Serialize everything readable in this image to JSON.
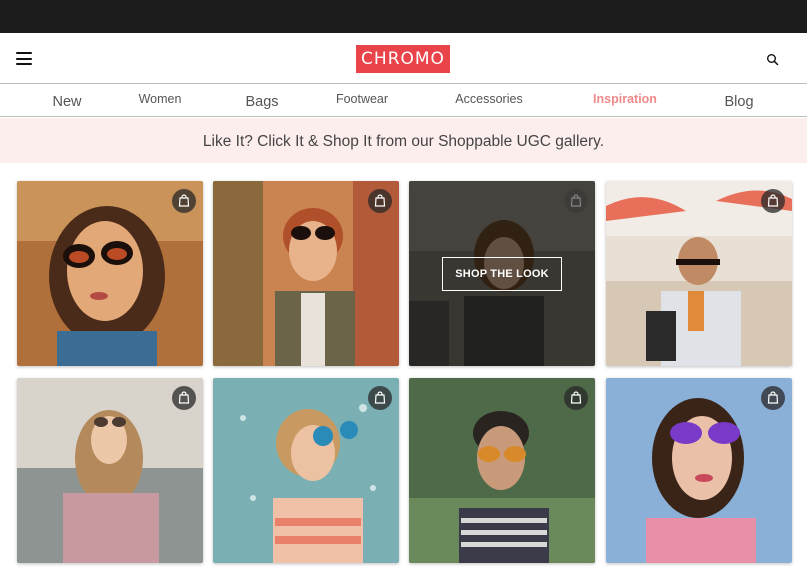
{
  "header": {
    "logo": "CHROMO",
    "menu_icon": "hamburger-menu-icon",
    "search_icon": "search-icon"
  },
  "nav": {
    "items": [
      {
        "label": "New"
      },
      {
        "label": "Women"
      },
      {
        "label": "Bags"
      },
      {
        "label": "Footwear"
      },
      {
        "label": "Accessories"
      },
      {
        "label": "Inspiration",
        "active": true
      },
      {
        "label": "Blog"
      }
    ]
  },
  "banner": {
    "text": "Like It? Click It & Shop It from our Shoppable UGC gallery."
  },
  "gallery": {
    "tile_icon": "shopping-bag-icon",
    "hover_button": "SHOP THE LOOK"
  },
  "colors": {
    "accent": "#e8444a",
    "active_nav": "#f08a8a",
    "banner_bg": "#fdeeee",
    "topbar": "#1c1c1c"
  }
}
